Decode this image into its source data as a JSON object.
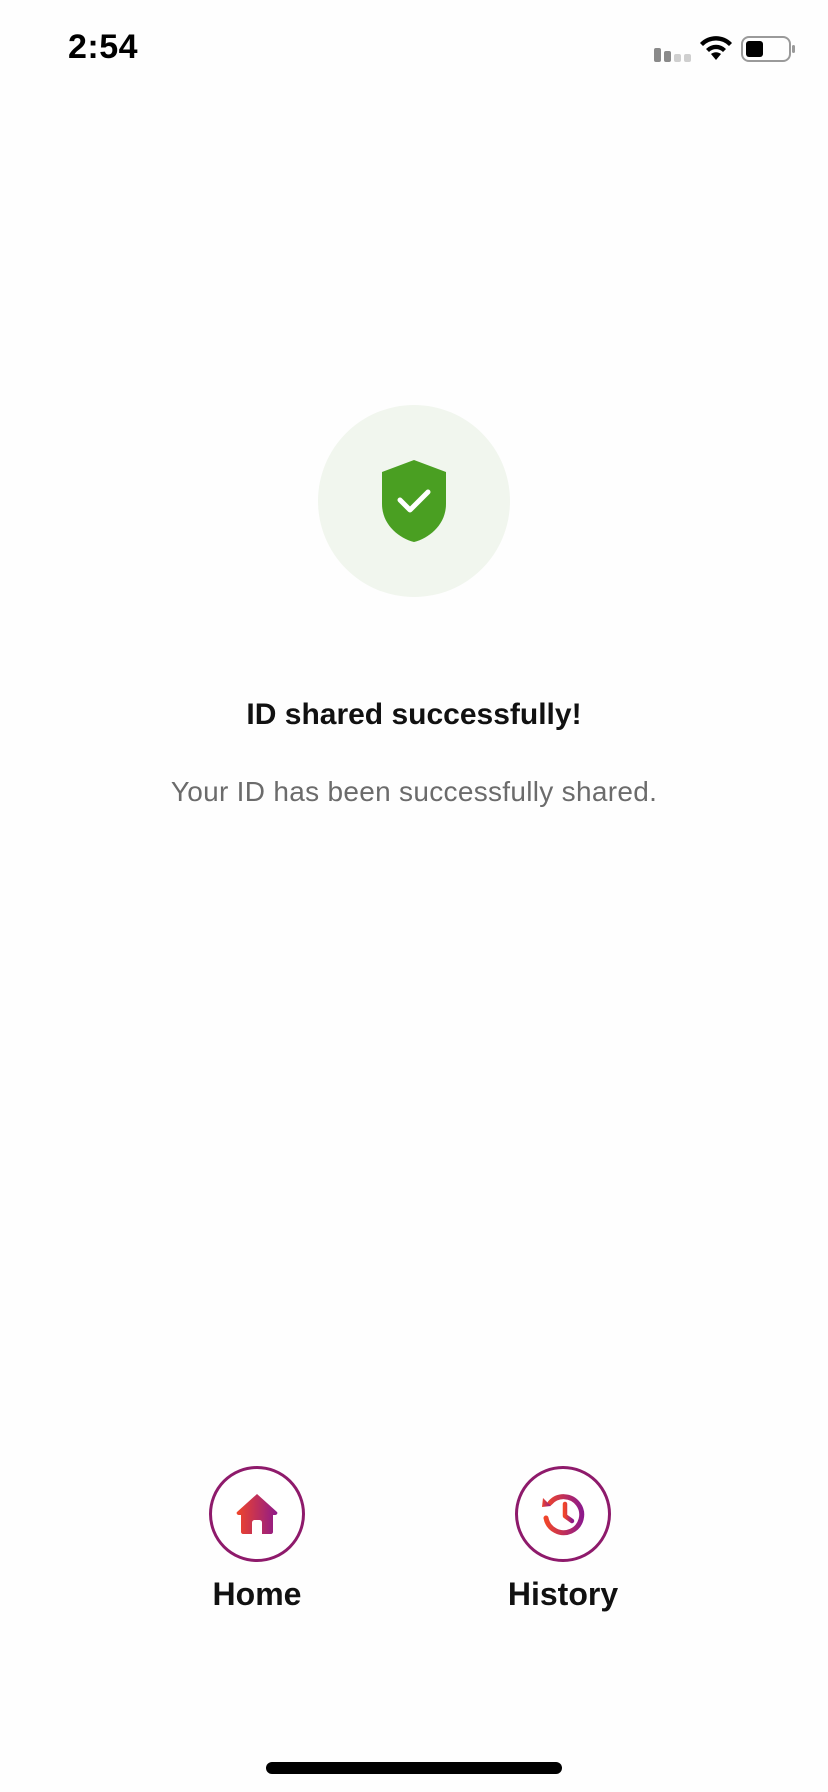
{
  "status_bar": {
    "time": "2:54"
  },
  "success": {
    "icon": "shield-check-icon",
    "circle_color": "#f1f6ee",
    "shield_color": "#4a9f22",
    "title": "ID shared successfully!",
    "message": "Your ID has been successfully shared."
  },
  "actions": {
    "home": {
      "label": "Home",
      "icon": "home-icon"
    },
    "history": {
      "label": "History",
      "icon": "history-icon"
    },
    "ring_color": "#8e1a6b",
    "gradient": [
      "#f0452a",
      "#8e1a8a"
    ]
  }
}
